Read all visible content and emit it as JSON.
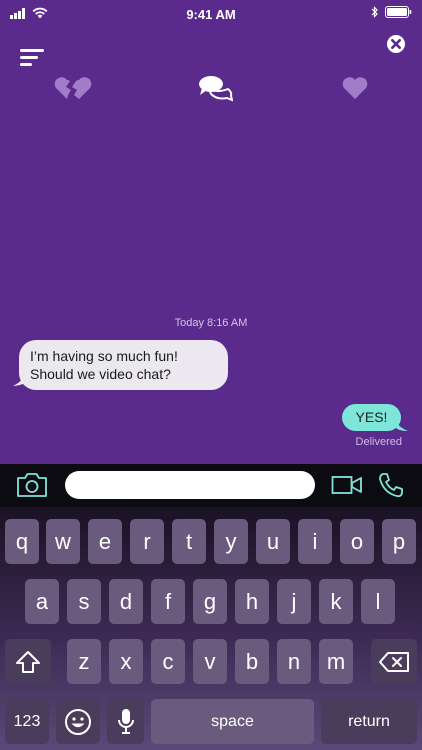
{
  "status_bar": {
    "time": "9:41 AM"
  },
  "colors": {
    "background": "#5a2a8c",
    "incoming_bubble": "#ebe8ef",
    "outgoing_bubble": "#7ee6d8",
    "accent": "#7ee6d8"
  },
  "conversation": {
    "timestamp": "Today 8:16 AM",
    "messages": [
      {
        "from": "them",
        "text": "I’m having so much fun! Should we video chat?"
      },
      {
        "from": "me",
        "text": "YES!"
      }
    ],
    "status": "Delivered"
  },
  "input_bar": {
    "placeholder": ""
  },
  "keyboard": {
    "row1": [
      "q",
      "w",
      "e",
      "r",
      "t",
      "y",
      "u",
      "i",
      "o",
      "p"
    ],
    "row2": [
      "a",
      "s",
      "d",
      "f",
      "g",
      "h",
      "j",
      "k",
      "l"
    ],
    "row3": [
      "z",
      "x",
      "c",
      "v",
      "b",
      "n",
      "m"
    ],
    "numbers_label": "123",
    "space_label": "space",
    "return_label": "return"
  },
  "icons": [
    "signal-icon",
    "wifi-icon",
    "bluetooth-icon",
    "battery-icon",
    "menu-icon",
    "close-icon",
    "broken-heart-icon",
    "chat-bubbles-icon",
    "heart-icon",
    "camera-icon",
    "video-icon",
    "phone-icon",
    "shift-icon",
    "backspace-icon",
    "emoji-icon",
    "microphone-icon"
  ]
}
